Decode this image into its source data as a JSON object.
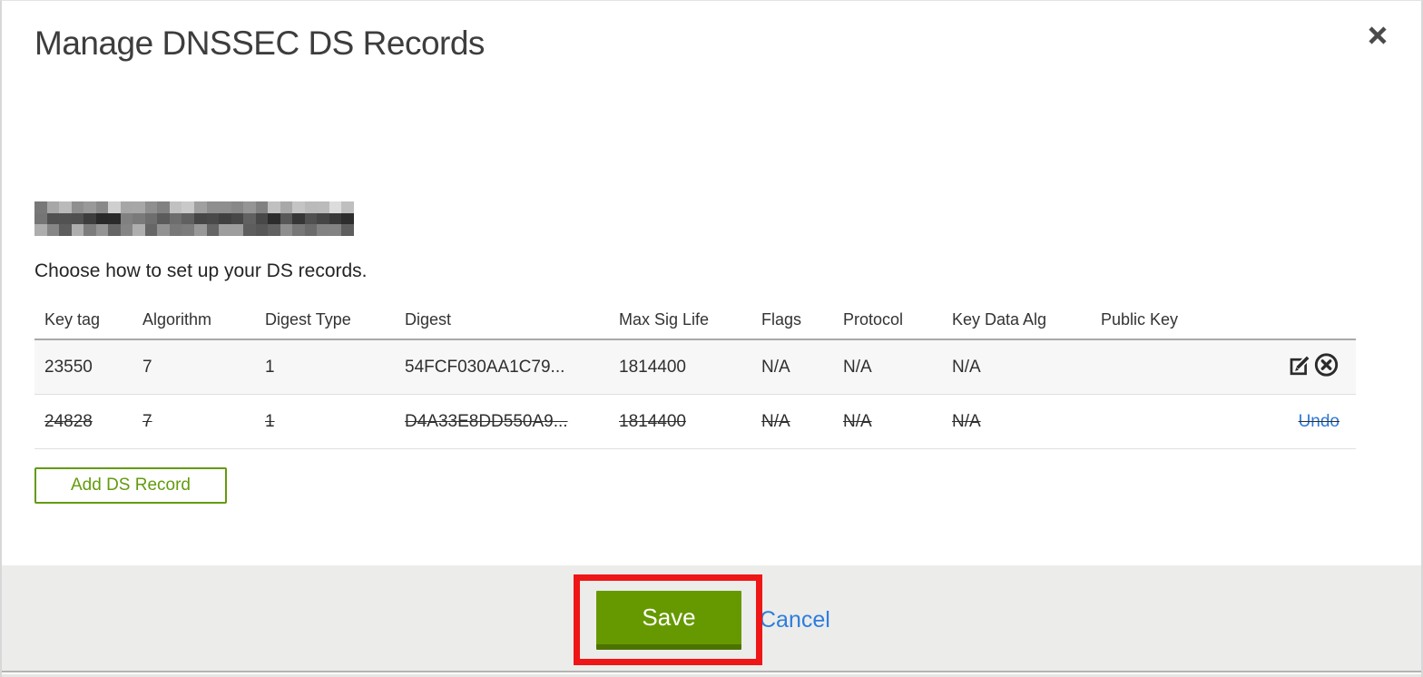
{
  "dialog": {
    "title": "Manage DNSSEC DS Records",
    "intro": "Choose how to set up your DS records.",
    "icons": {
      "close": "x-cross",
      "edit": "pencil-on-square",
      "delete": "x-in-circle"
    },
    "table": {
      "columns": [
        "Key tag",
        "Algorithm",
        "Digest Type",
        "Digest",
        "Max Sig Life",
        "Flags",
        "Protocol",
        "Key Data Alg",
        "Public Key"
      ],
      "rows": [
        {
          "key_tag": "23550",
          "algorithm": "7",
          "digest_type": "1",
          "digest": "54FCF030AA1C79...",
          "max_sig_life": "1814400",
          "flags": "N/A",
          "protocol": "N/A",
          "key_data_alg": "N/A",
          "public_key": "",
          "state": "normal"
        },
        {
          "key_tag": "24828",
          "algorithm": "7",
          "digest_type": "1",
          "digest": "D4A33E8DD550A9...",
          "max_sig_life": "1814400",
          "flags": "N/A",
          "protocol": "N/A",
          "key_data_alg": "N/A",
          "public_key": "",
          "state": "deleted",
          "undo_label": "Undo"
        }
      ]
    },
    "add_button_label": "Add DS Record",
    "footer": {
      "save_label": "Save",
      "cancel_label": "Cancel"
    },
    "colors": {
      "button_green": "#669900",
      "button_green_dark": "#4c7300",
      "outline_green": "#639b0d",
      "link_blue": "#2d7ede",
      "annotation_red": "#ee1616"
    }
  }
}
